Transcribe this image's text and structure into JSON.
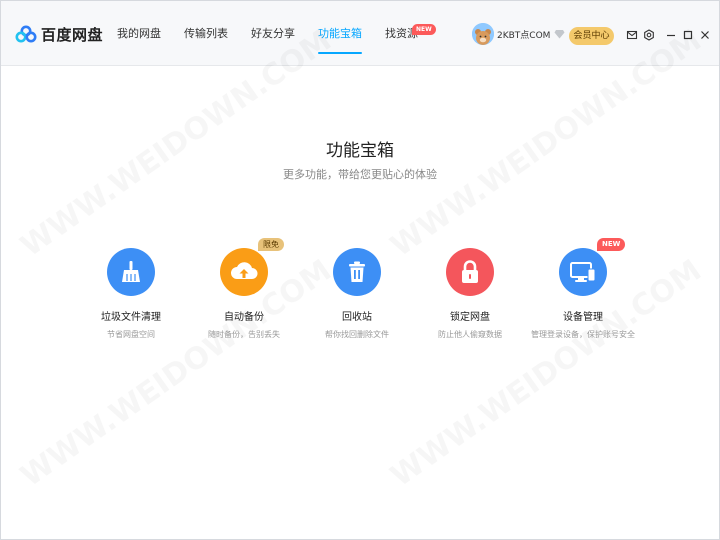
{
  "app": {
    "name": "百度网盘"
  },
  "nav": [
    {
      "label": "我的网盘"
    },
    {
      "label": "传输列表"
    },
    {
      "label": "好友分享"
    },
    {
      "label": "功能宝箱",
      "active": true
    },
    {
      "label": "找资源",
      "badge": "NEW"
    }
  ],
  "user": {
    "name": "2KBT点COM",
    "vip_label": "会员中心"
  },
  "page": {
    "title": "功能宝箱",
    "subtitle": "更多功能，带给您更贴心的体验"
  },
  "tools": [
    {
      "name": "垃圾文件清理",
      "desc": "节省网盘空间",
      "icon": "broom-icon",
      "color": "#3d8ff5"
    },
    {
      "name": "自动备份",
      "desc": "随时备份，告别丢失",
      "icon": "cloud-upload-icon",
      "color": "#fa9d16",
      "badge": "限免"
    },
    {
      "name": "回收站",
      "desc": "帮你找回删除文件",
      "icon": "trash-icon",
      "color": "#3d8ff5"
    },
    {
      "name": "锁定网盘",
      "desc": "防止他人偷窥数据",
      "icon": "lock-icon",
      "color": "#f4565c"
    },
    {
      "name": "设备管理",
      "desc": "管理登录设备，保护账号安全",
      "icon": "devices-icon",
      "color": "#3d8ff5",
      "badge": "NEW"
    }
  ],
  "watermark": "WWW.WEIDOWN.COM",
  "colors": {
    "accent": "#06a7ff",
    "vip": "#f4c96b",
    "new_badge": "#fc5a5a"
  }
}
